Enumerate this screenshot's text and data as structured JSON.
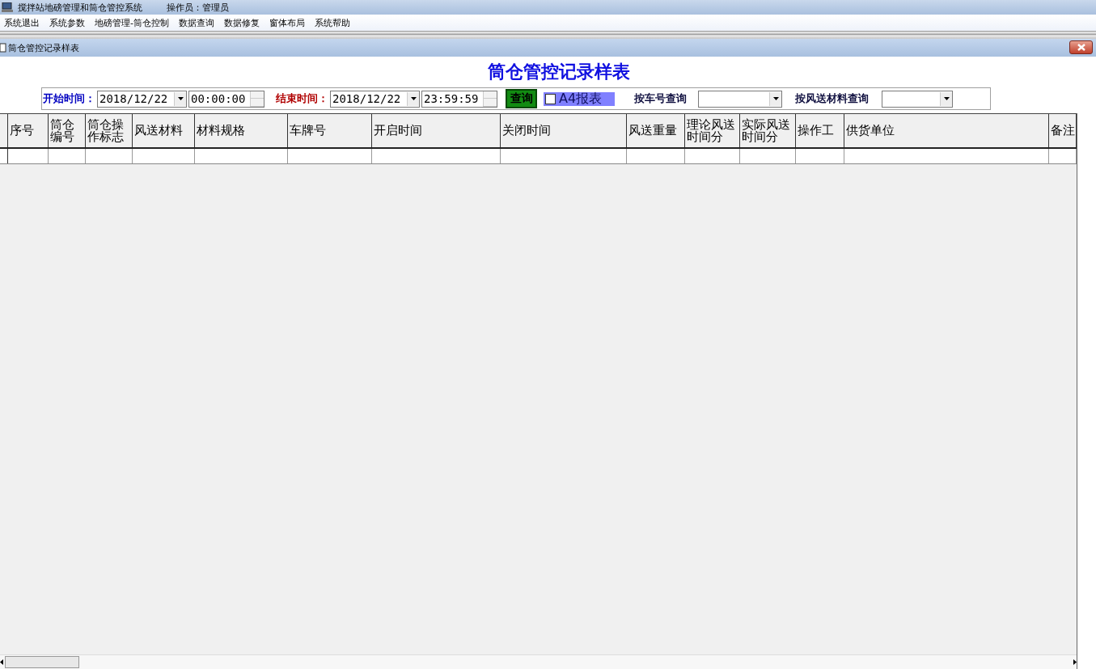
{
  "window": {
    "title": "搅拌站地磅管理和筒仓管控系统",
    "operator": "操作员：管理员"
  },
  "menu": [
    "系统退出",
    "系统参数",
    "地磅管理-筒仓控制",
    "数据查询",
    "数据修复",
    "窗体布局",
    "系统帮助"
  ],
  "child_window": {
    "title": "筒仓管控记录样表"
  },
  "report_title": "筒仓管控记录样表",
  "filters": {
    "start_label": "开始时间：",
    "start_date": "2018/12/22",
    "start_time": "00:00:00",
    "end_label": "结束时间：",
    "end_date": "2018/12/22",
    "end_time": "23:59:59",
    "query_button": "查询",
    "a4_report": {
      "label": "A4报表",
      "checked": false
    },
    "by_plate_label": "按车号查询",
    "by_material_label": "按风送材料查询"
  },
  "table": {
    "columns": [
      "序号",
      "筒仓编号",
      "筒仓操作标志",
      "风送材料",
      "材料规格",
      "车牌号",
      "开启时间",
      "关闭时间",
      "风送重量",
      "理论风送时间分",
      "实际风送时间分",
      "操作工",
      "供货单位",
      "备注"
    ]
  }
}
